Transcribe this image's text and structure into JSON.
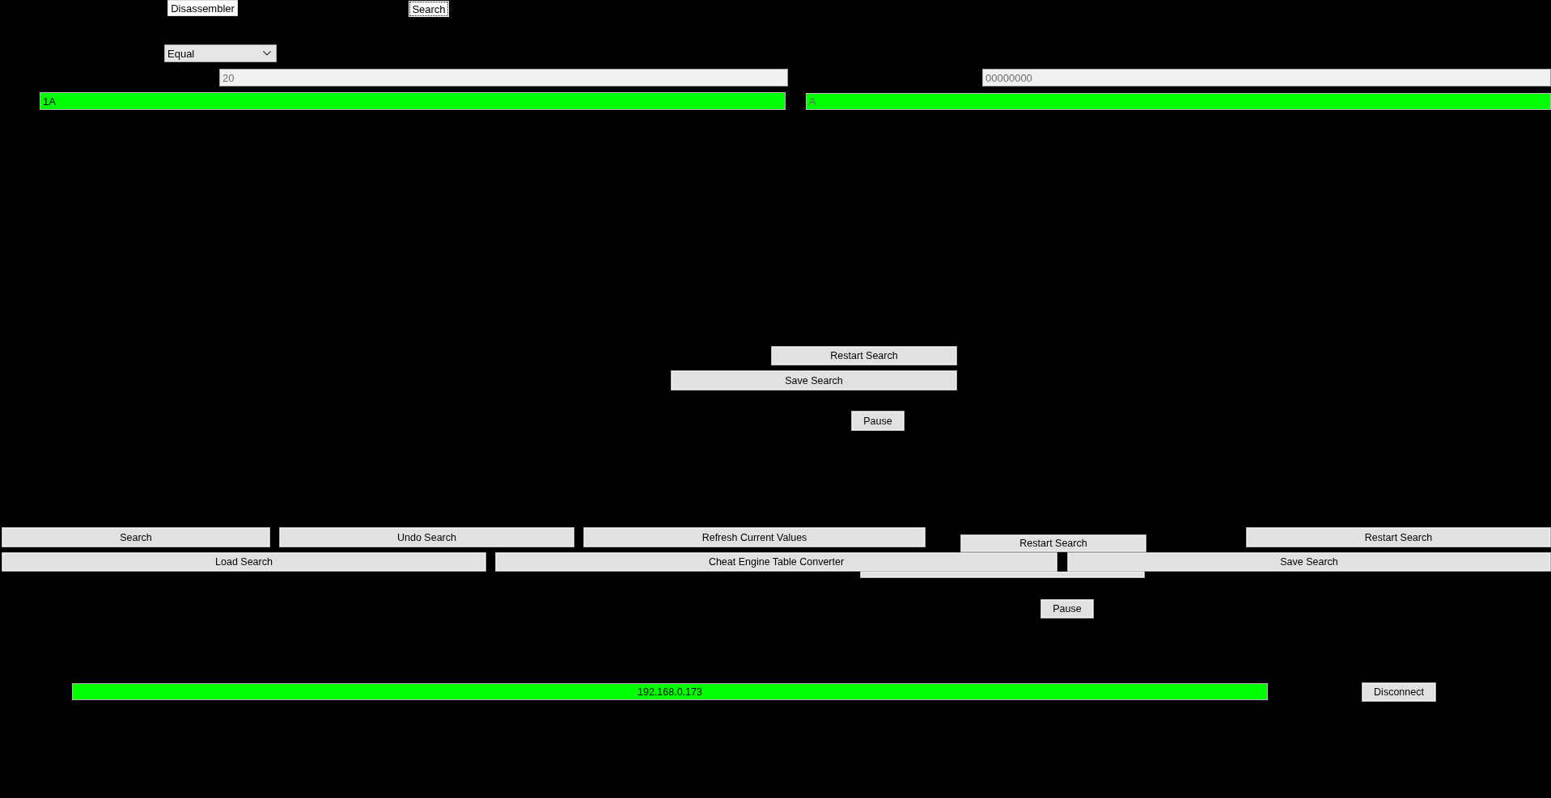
{
  "top_buttons": [
    {
      "label": "Disassembler",
      "focused": false
    },
    {
      "label": "Search",
      "focused": true
    }
  ],
  "compare_dropdown": {
    "value": "Equal"
  },
  "value_field": {
    "value": "20",
    "disabled": true
  },
  "address_field": {
    "value": "00000000",
    "disabled": true
  },
  "result_fields": [
    {
      "value": "1A",
      "disabled": false
    },
    {
      "value": "A",
      "disabled": true
    }
  ],
  "middle_panel": {
    "buttons": [
      {
        "label": "Restart Search",
        "covered": false
      },
      {
        "label": "Save Search",
        "covered": false
      },
      {
        "label": "Pause",
        "covered": false
      }
    ]
  },
  "lower_panel": {
    "buttons": [
      {
        "label": "Restart Search",
        "covered": false
      },
      {
        "covered": true
      },
      {
        "label": "Pause",
        "covered": false
      }
    ]
  },
  "action_buttons": [
    "Search",
    "Undo Search",
    "Refresh Current Values",
    "Load Search",
    "Cheat Engine Table Converter",
    "Restart Search",
    "Save Search"
  ],
  "connection": {
    "address": "192.168.0.173",
    "button": "Disconnect"
  }
}
